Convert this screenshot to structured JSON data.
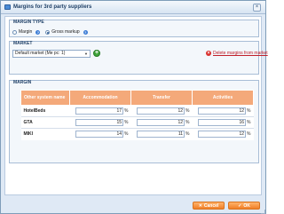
{
  "window": {
    "title": "Margins for 3rd party suppliers",
    "close_glyph": "×"
  },
  "margin_type": {
    "legend": "MARGIN TYPE",
    "options": [
      {
        "label": "Margin",
        "selected": false
      },
      {
        "label": "Gross markup",
        "selected": true
      }
    ],
    "help_glyph": "?"
  },
  "market": {
    "legend": "MARKET",
    "selected": "Default market (Me pc: 1)",
    "dropdown_glyph": "▼",
    "add_glyph": "+",
    "delete_glyph": "×",
    "delete_label": "Delete margins from market"
  },
  "margin": {
    "legend": "MARGIN",
    "columns": [
      "Other system name",
      "Accommodation",
      "Transfer",
      "Activities"
    ],
    "percent_sign": "%",
    "rows": [
      {
        "name": "HotelBeds",
        "accommodation": "17",
        "transfer": "12",
        "activities": "12"
      },
      {
        "name": "GTA",
        "accommodation": "15",
        "transfer": "12",
        "activities": "16"
      },
      {
        "name": "MIKI",
        "accommodation": "14",
        "transfer": "11",
        "activities": "12"
      }
    ]
  },
  "footer": {
    "cancel_label": "Cancel",
    "cancel_glyph": "✕",
    "ok_label": "OK",
    "ok_glyph": "✓"
  },
  "colors": {
    "header_orange": "#f4a97a",
    "button_orange": "#f07e27",
    "delete_red": "#d9302c",
    "add_green": "#3fa43a"
  }
}
